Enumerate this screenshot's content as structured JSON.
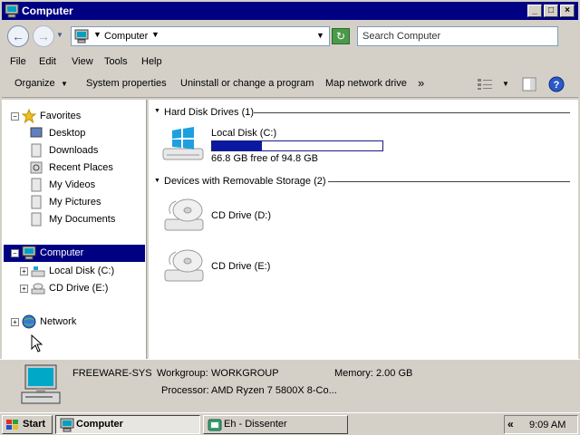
{
  "window": {
    "title": "Computer",
    "controls": {
      "minimize": "_",
      "maximize": "□",
      "close": "×"
    }
  },
  "addressbar": {
    "location": "Computer",
    "search_placeholder": "Search Computer"
  },
  "menu": [
    "File",
    "Edit",
    "View",
    "Tools",
    "Help"
  ],
  "commands": {
    "organize": "Organize",
    "system_properties": "System properties",
    "uninstall": "Uninstall or change a program",
    "map_drive": "Map network drive",
    "more": "»"
  },
  "navpane": {
    "favorites": "Favorites",
    "favorites_items": [
      "Desktop",
      "Downloads",
      "Recent Places",
      "My Videos",
      "My Pictures",
      "My Documents"
    ],
    "computer": "Computer",
    "computer_items": [
      "Local Disk (C:)",
      "CD Drive (E:)"
    ],
    "network": "Network"
  },
  "content": {
    "hdd_header": "Hard Disk Drives (1)",
    "local_disk_name": "Local Disk (C:)",
    "local_disk_free": "66.8 GB free of 94.8 GB",
    "local_disk_used_fraction": 0.295,
    "removable_header": "Devices with Removable Storage (2)",
    "cd_drives": [
      "CD Drive (D:)",
      "CD Drive (E:)"
    ]
  },
  "details": {
    "computer_name": "FREEWARE-SYS",
    "workgroup_label": "Workgroup:",
    "workgroup_value": "WORKGROUP",
    "memory_label": "Memory:",
    "memory_value": "2.00 GB",
    "processor_label": "Processor:",
    "processor_value": "AMD Ryzen 7 5800X 8-Co..."
  },
  "taskbar": {
    "start": "Start",
    "tasks": [
      "Computer",
      "Eh - Dissenter"
    ],
    "tray_arrows": "«",
    "clock": "9:09 AM"
  },
  "colors": {
    "titlebar": "#000082",
    "selection": "#000082",
    "disk_bar": "#0a1aa0",
    "window_face": "#d4d0c8"
  }
}
